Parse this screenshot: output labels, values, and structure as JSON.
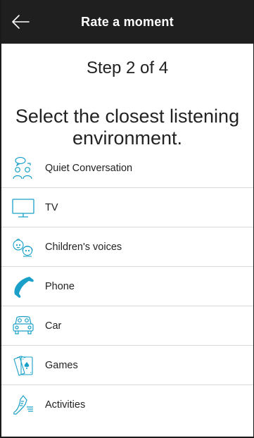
{
  "header": {
    "title": "Rate a moment",
    "back_icon": "arrow-left-icon"
  },
  "step": "Step 2 of 4",
  "prompt": "Select the closest listening environment.",
  "accent_color": "#1aa0c8",
  "environments": [
    {
      "label": "Quiet Conversation",
      "icon": "conversation-icon"
    },
    {
      "label": "TV",
      "icon": "tv-icon"
    },
    {
      "label": "Children's voices",
      "icon": "children-icon"
    },
    {
      "label": "Phone",
      "icon": "phone-icon"
    },
    {
      "label": "Car",
      "icon": "car-icon"
    },
    {
      "label": "Games",
      "icon": "cards-icon"
    },
    {
      "label": "Activities",
      "icon": "sneaker-icon"
    }
  ]
}
